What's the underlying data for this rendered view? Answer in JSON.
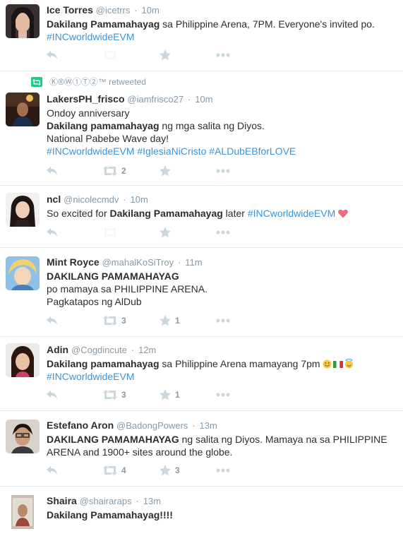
{
  "tweets": [
    {
      "fullname": "Ice Torres",
      "handle": "@icetrrs",
      "time": "10m",
      "line1_bold": "Dakilang Pamamahayag",
      "line1_rest": " sa Philippine Arena, 7PM. Everyone's invited po.",
      "hashtags": "#INCworldwideEVM",
      "retweets": "",
      "likes": ""
    },
    {
      "retweeted_by": "Ⓚ®Ⓦ①Ⓣ②™ retweeted",
      "fullname": "LakersPH_frisco",
      "handle": "@iamfrisco27",
      "time": "10m",
      "line0": "Ondoy anniversary",
      "line1_bold": "Dakilang pamamahayag",
      "line1_rest": " ng mga salita ng Diyos.",
      "line2": "National Pabebe Wave day!",
      "hashtags": "#INCworldwideEVM #IglesiaNiCristo #ALDubEBforLOVE",
      "retweets": "2",
      "likes": ""
    },
    {
      "fullname": "ncl",
      "handle": "@nicolecmdv",
      "time": "10m",
      "line1_pre": "So excited for ",
      "line1_bold": "Dakilang Pamamahayag",
      "line1_rest": " later ",
      "hashtags": "#INCworldwideEVM",
      "retweets": "",
      "likes": ""
    },
    {
      "fullname": "Mint Royce",
      "handle": "@mahalKoSiTroy",
      "time": "11m",
      "line1_bold": "DAKILANG PAMAMAHAYAG",
      "line2": "po mamaya sa PHILIPPINE ARENA.",
      "line3": "Pagkatapos ng AlDub",
      "retweets": "3",
      "likes": "1"
    },
    {
      "fullname": "Adin",
      "handle": "@Cogdincute",
      "time": "12m",
      "line1_bold": "Dakilang pamamahayag",
      "line1_rest": " sa Philippine Arena mamayang 7pm ",
      "hashtags": "#INCworldwideEVM",
      "retweets": "3",
      "likes": "1"
    },
    {
      "fullname": "Estefano Aron",
      "handle": "@BadongPowers",
      "time": "13m",
      "line1_bold": "DAKILANG PAMAMAHAYAG",
      "line1_rest": " ng salita ng Diyos. Mamaya na sa PHILIPPINE",
      "line2": "ARENA and 1900+ sites around the globe.",
      "retweets": "4",
      "likes": "3"
    },
    {
      "fullname": "Shaira",
      "handle": "@shairaraps",
      "time": "13m",
      "line1_bold": "Dakilang Pamamahayag!!!!"
    }
  ],
  "separator": "·",
  "icons": {
    "reply": "reply-icon",
    "retweet": "retweet-icon",
    "like": "star-icon",
    "more": "more-icon",
    "retweeted": "retweet-badge-icon",
    "heart": "heart-emoji-icon"
  },
  "colors": {
    "link": "#3b94d9",
    "muted": "#8899a6",
    "text": "#292f33",
    "icon": "#ccd6dd",
    "retweet": "#19cf86"
  }
}
